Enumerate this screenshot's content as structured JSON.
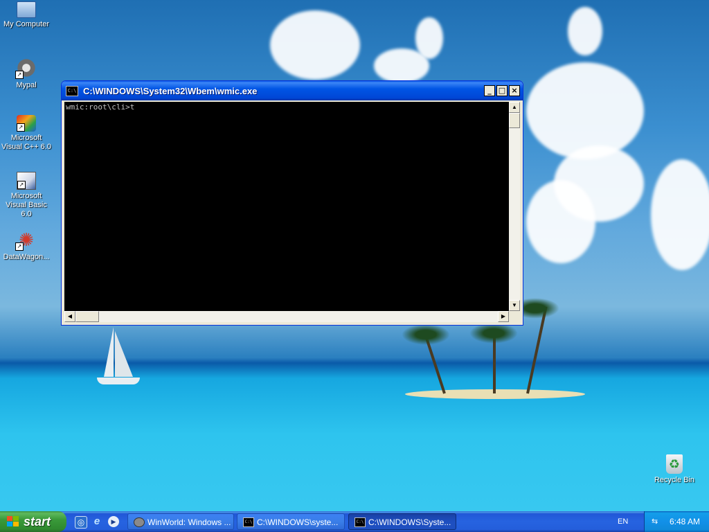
{
  "desktop": {
    "icons": [
      {
        "label": "My Computer",
        "icon": "my-computer-icon",
        "shortcut": false
      },
      {
        "label": "Mypal",
        "icon": "raccoon-icon",
        "shortcut": true
      },
      {
        "label": "Microsoft Visual C++ 6.0",
        "icon": "visual-cpp-icon",
        "shortcut": true
      },
      {
        "label": "Microsoft Visual Basic 6.0",
        "icon": "visual-basic-icon",
        "shortcut": true
      },
      {
        "label": "DataWagon...",
        "icon": "datawagon-icon",
        "shortcut": true
      },
      {
        "label": "Recycle Bin",
        "icon": "recycle-bin-icon",
        "shortcut": false
      }
    ]
  },
  "console": {
    "title": "C:\\WINDOWS\\System32\\Wbem\\wmic.exe",
    "icon_text": "C:\\",
    "buttons": {
      "minimize": "_",
      "maximize": "□",
      "close": "×"
    },
    "prompt": "wmic:root\\cli>t"
  },
  "taskbar": {
    "start_label": "start",
    "quick_launch": [
      "windows-update-icon",
      "internet-explorer-icon",
      "media-player-icon"
    ],
    "tasks": [
      {
        "label": "WinWorld: Windows ...",
        "icon": "raccoon-icon",
        "active": false
      },
      {
        "label": "C:\\WINDOWS\\syste...",
        "icon": "console-icon",
        "active": false
      },
      {
        "label": "C:\\WINDOWS\\Syste...",
        "icon": "console-icon",
        "active": true
      }
    ],
    "language": "EN",
    "clock": "6:48 AM"
  },
  "colors": {
    "titlebar_blue": "#0055e5",
    "taskbar_blue": "#245edb",
    "start_green": "#3a9a3a",
    "console_bg": "#000000",
    "console_text": "#c0c0c0"
  }
}
